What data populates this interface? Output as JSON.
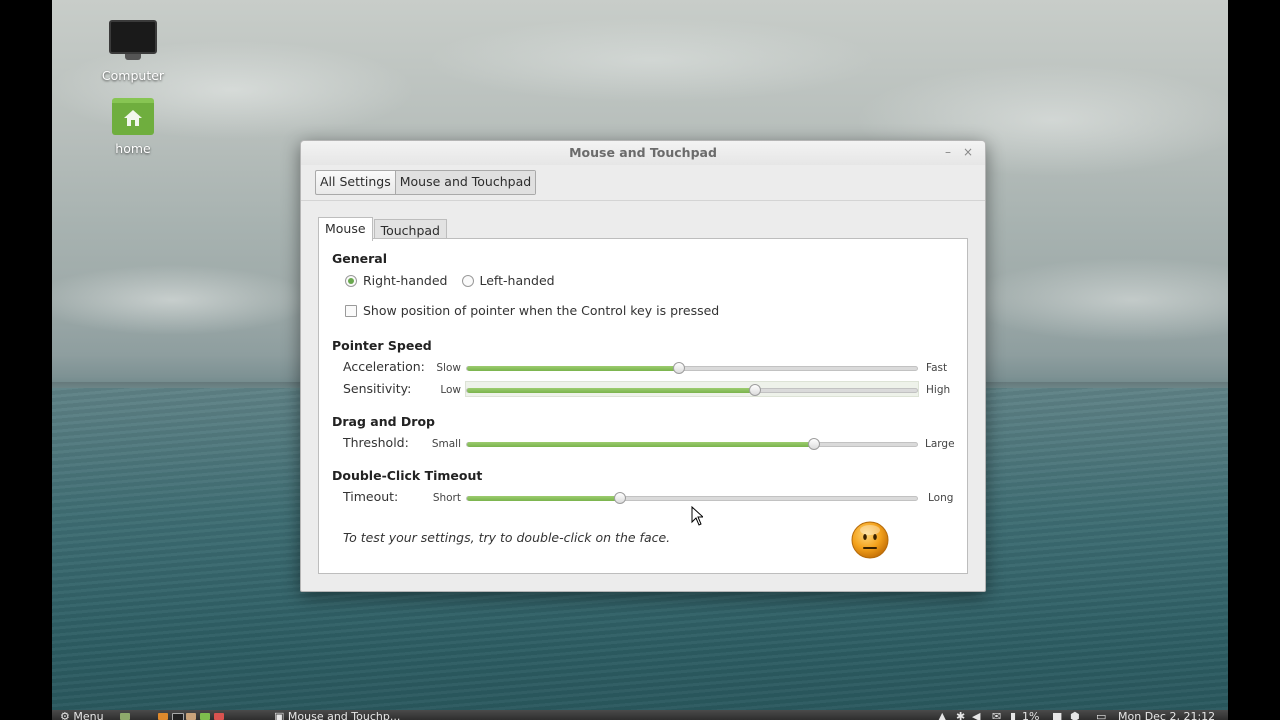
{
  "desktop": {
    "icons": [
      {
        "label": "Computer",
        "icon": "computer-icon"
      },
      {
        "label": "home",
        "icon": "home-folder-icon"
      }
    ]
  },
  "window": {
    "title": "Mouse and Touchpad",
    "minimize_symbol": "–",
    "close_symbol": "×",
    "breadcrumb": [
      "All Settings",
      "Mouse and Touchpad"
    ],
    "tabs": [
      "Mouse",
      "Touchpad"
    ],
    "active_tab": "Mouse",
    "general": {
      "heading": "General",
      "right_handed": "Right-handed",
      "left_handed": "Left-handed",
      "selected_hand": "Right-handed",
      "show_pointer": "Show position of pointer when the Control key is pressed",
      "show_pointer_checked": false
    },
    "pointer_speed": {
      "heading": "Pointer Speed",
      "acceleration": {
        "label": "Acceleration:",
        "min": "Slow",
        "max": "Fast",
        "value": 0.47
      },
      "sensitivity": {
        "label": "Sensitivity:",
        "min": "Low",
        "max": "High",
        "value": 0.64
      }
    },
    "drag_drop": {
      "heading": "Drag and Drop",
      "threshold": {
        "label": "Threshold:",
        "min": "Small",
        "max": "Large",
        "value": 0.77
      }
    },
    "double_click": {
      "heading": "Double-Click Timeout",
      "timeout": {
        "label": "Timeout:",
        "min": "Short",
        "max": "Long",
        "value": 0.34
      }
    },
    "test_hint": "To test your settings, try to double-click on the face."
  },
  "taskbar": {
    "menu_label": "Menu",
    "task_label": "Mouse and Touchp...",
    "battery": "1%",
    "clock": "Mon Dec 2, 21:12"
  },
  "colors": {
    "accent_green": "#7ab44d",
    "face_orange": "#f4a21c"
  }
}
